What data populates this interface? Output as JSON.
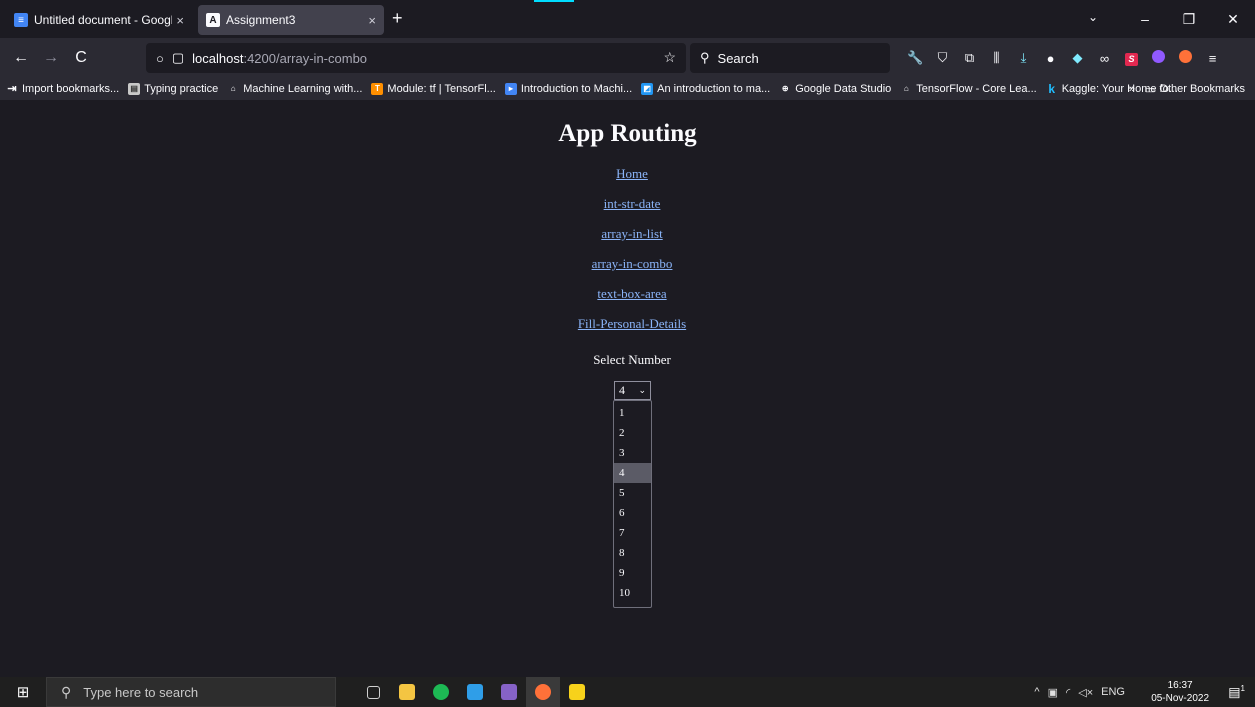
{
  "browser": {
    "tabs": [
      {
        "title": "Untitled document - Google Do",
        "favicon": "docs-icon",
        "close": "×",
        "active": false
      },
      {
        "title": "Assignment3",
        "favicon": "angular-icon",
        "close": "×",
        "active": true
      }
    ],
    "new_tab": "+",
    "tab_list": "⌄",
    "window_controls": {
      "minimize": "–",
      "restore": "❐",
      "close": "✕"
    },
    "nav": {
      "back": "←",
      "forward": "→",
      "reload": "C"
    },
    "url": {
      "host": "localhost",
      "path": ":4200/array-in-combo"
    },
    "search": {
      "placeholder": "Search"
    },
    "bookmarks": [
      {
        "label": "Import bookmarks...",
        "icon": "import-icon"
      },
      {
        "label": "Typing practice",
        "icon": "typing-icon"
      },
      {
        "label": "Machine Learning with...",
        "icon": "ml-icon"
      },
      {
        "label": "Module: tf | TensorFl...",
        "icon": "tensorflow-icon"
      },
      {
        "label": "Introduction to Machi...",
        "icon": "intro-icon"
      },
      {
        "label": "An introduction to ma...",
        "icon": "intro2-icon"
      },
      {
        "label": "Google Data Studio",
        "icon": "globe-icon"
      },
      {
        "label": "TensorFlow - Core Lea...",
        "icon": "ml-icon"
      },
      {
        "label": "Kaggle: Your Home fo...",
        "icon": "kaggle-icon"
      }
    ],
    "bookmarks_overflow": "»",
    "other_bookmarks": "Other Bookmarks"
  },
  "page": {
    "title": "App Routing",
    "links": [
      "Home",
      "int-str-date",
      "array-in-list",
      "array-in-combo",
      "text-box-area",
      "Fill-Personal-Details"
    ],
    "select_label": "Select Number",
    "selected_value": "4",
    "options": [
      "1",
      "2",
      "3",
      "4",
      "5",
      "6",
      "7",
      "8",
      "9",
      "10"
    ],
    "highlighted_option": "4"
  },
  "taskbar": {
    "search_placeholder": "Type here to search",
    "language": "ENG",
    "time": "16:37",
    "date": "05-Nov-2022",
    "notification_count": "1"
  },
  "colors": {
    "page_bg": "#1c1b22",
    "link": "#8ab4f8",
    "toolbar_bg": "#2b2a33",
    "highlight": "#5b5b66"
  }
}
